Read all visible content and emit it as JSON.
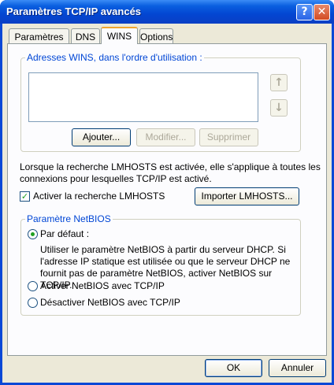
{
  "window": {
    "title": "Paramètres TCP/IP avancés",
    "help": "?",
    "close": "✕"
  },
  "tabs": [
    "Paramètres IP",
    "DNS",
    "WINS",
    "Options"
  ],
  "wins": {
    "group_label": "Adresses WINS, dans l'ordre d'utilisation :",
    "up_arrow": "↑",
    "down_arrow": "↓",
    "add": "Ajouter...",
    "modify": "Modifier...",
    "remove": "Supprimer"
  },
  "lmhosts": {
    "description_line1": "Lorsque la recherche LMHOSTS est activée, elle s'applique à toutes les",
    "description_line2": "connexions pour lesquelles TCP/IP est activé.",
    "checkbox_label": "Activer la recherche LMHOSTS",
    "checkbox_mark": "✓",
    "import": "Importer LMHOSTS..."
  },
  "netbios": {
    "group_label": "Paramètre NetBIOS",
    "default_label": "Par défaut :",
    "default_desc_line1": "Utiliser le paramètre NetBIOS à partir du serveur DHCP. Si",
    "default_desc_line2": "l'adresse IP statique est utilisée ou que le serveur DHCP ne",
    "default_desc_line3": "fournit pas de paramètre NetBIOS, activer NetBIOS sur TCP/IP.",
    "enable_label": "Activer NetBIOS avec TCP/IP",
    "disable_label": "Désactiver NetBIOS avec TCP/IP"
  },
  "footer": {
    "ok": "OK",
    "cancel": "Annuler"
  }
}
